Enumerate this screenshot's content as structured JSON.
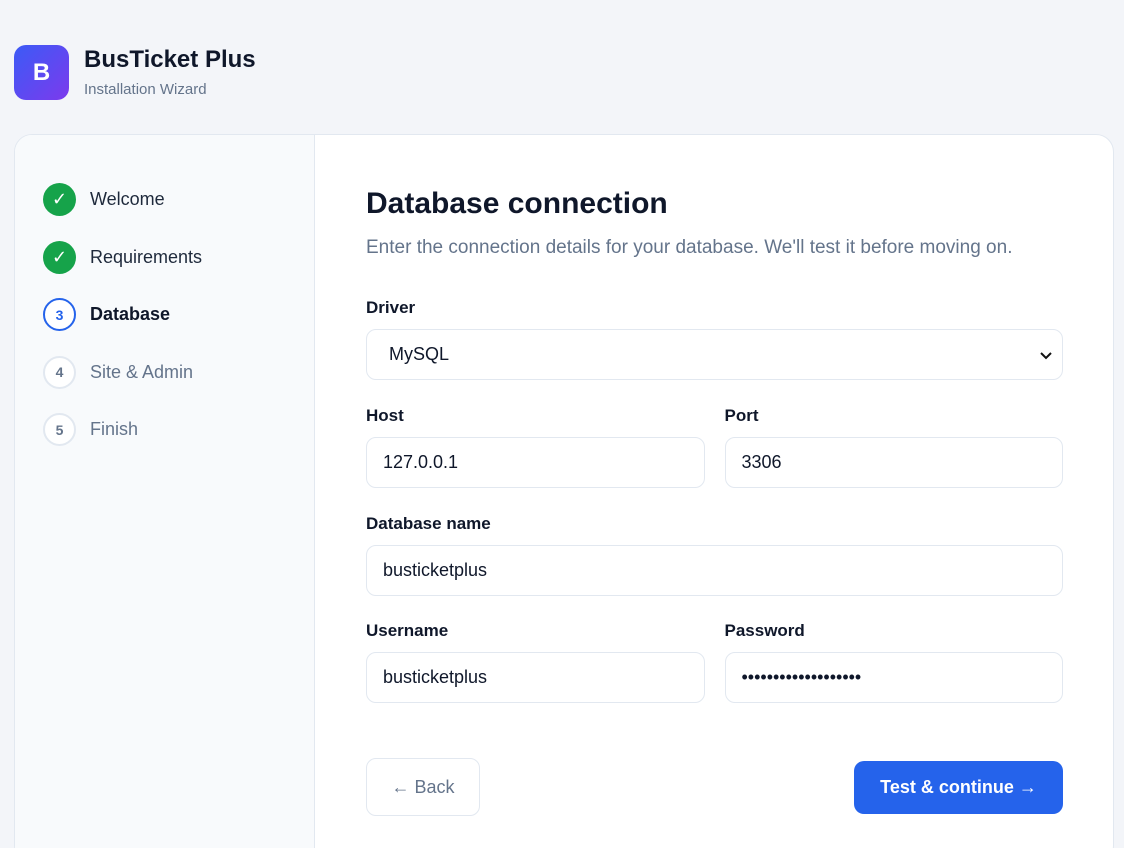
{
  "brand": {
    "logo_letter": "B",
    "title": "BusTicket Plus",
    "subtitle": "Installation Wizard"
  },
  "steps": [
    {
      "number": "✓",
      "label": "Welcome",
      "state": "done"
    },
    {
      "number": "✓",
      "label": "Requirements",
      "state": "done"
    },
    {
      "number": "3",
      "label": "Database",
      "state": "active"
    },
    {
      "number": "4",
      "label": "Site & Admin",
      "state": "todo"
    },
    {
      "number": "5",
      "label": "Finish",
      "state": "todo"
    }
  ],
  "form": {
    "title": "Database connection",
    "subtitle": "Enter the connection details for your database. We'll test it before moving on.",
    "driver": {
      "label": "Driver",
      "value": "MySQL"
    },
    "host": {
      "label": "Host",
      "value": "127.0.0.1"
    },
    "port": {
      "label": "Port",
      "value": "3306"
    },
    "database": {
      "label": "Database name",
      "value": "busticketplus"
    },
    "username": {
      "label": "Username",
      "value": "busticketplus"
    },
    "password": {
      "label": "Password",
      "value": "•••••••••••••••••••"
    }
  },
  "actions": {
    "back_label": "← Back",
    "next_label": "Test & continue →"
  },
  "colors": {
    "primary": "#2563eb",
    "success": "#16a34a",
    "muted": "#64748b"
  }
}
